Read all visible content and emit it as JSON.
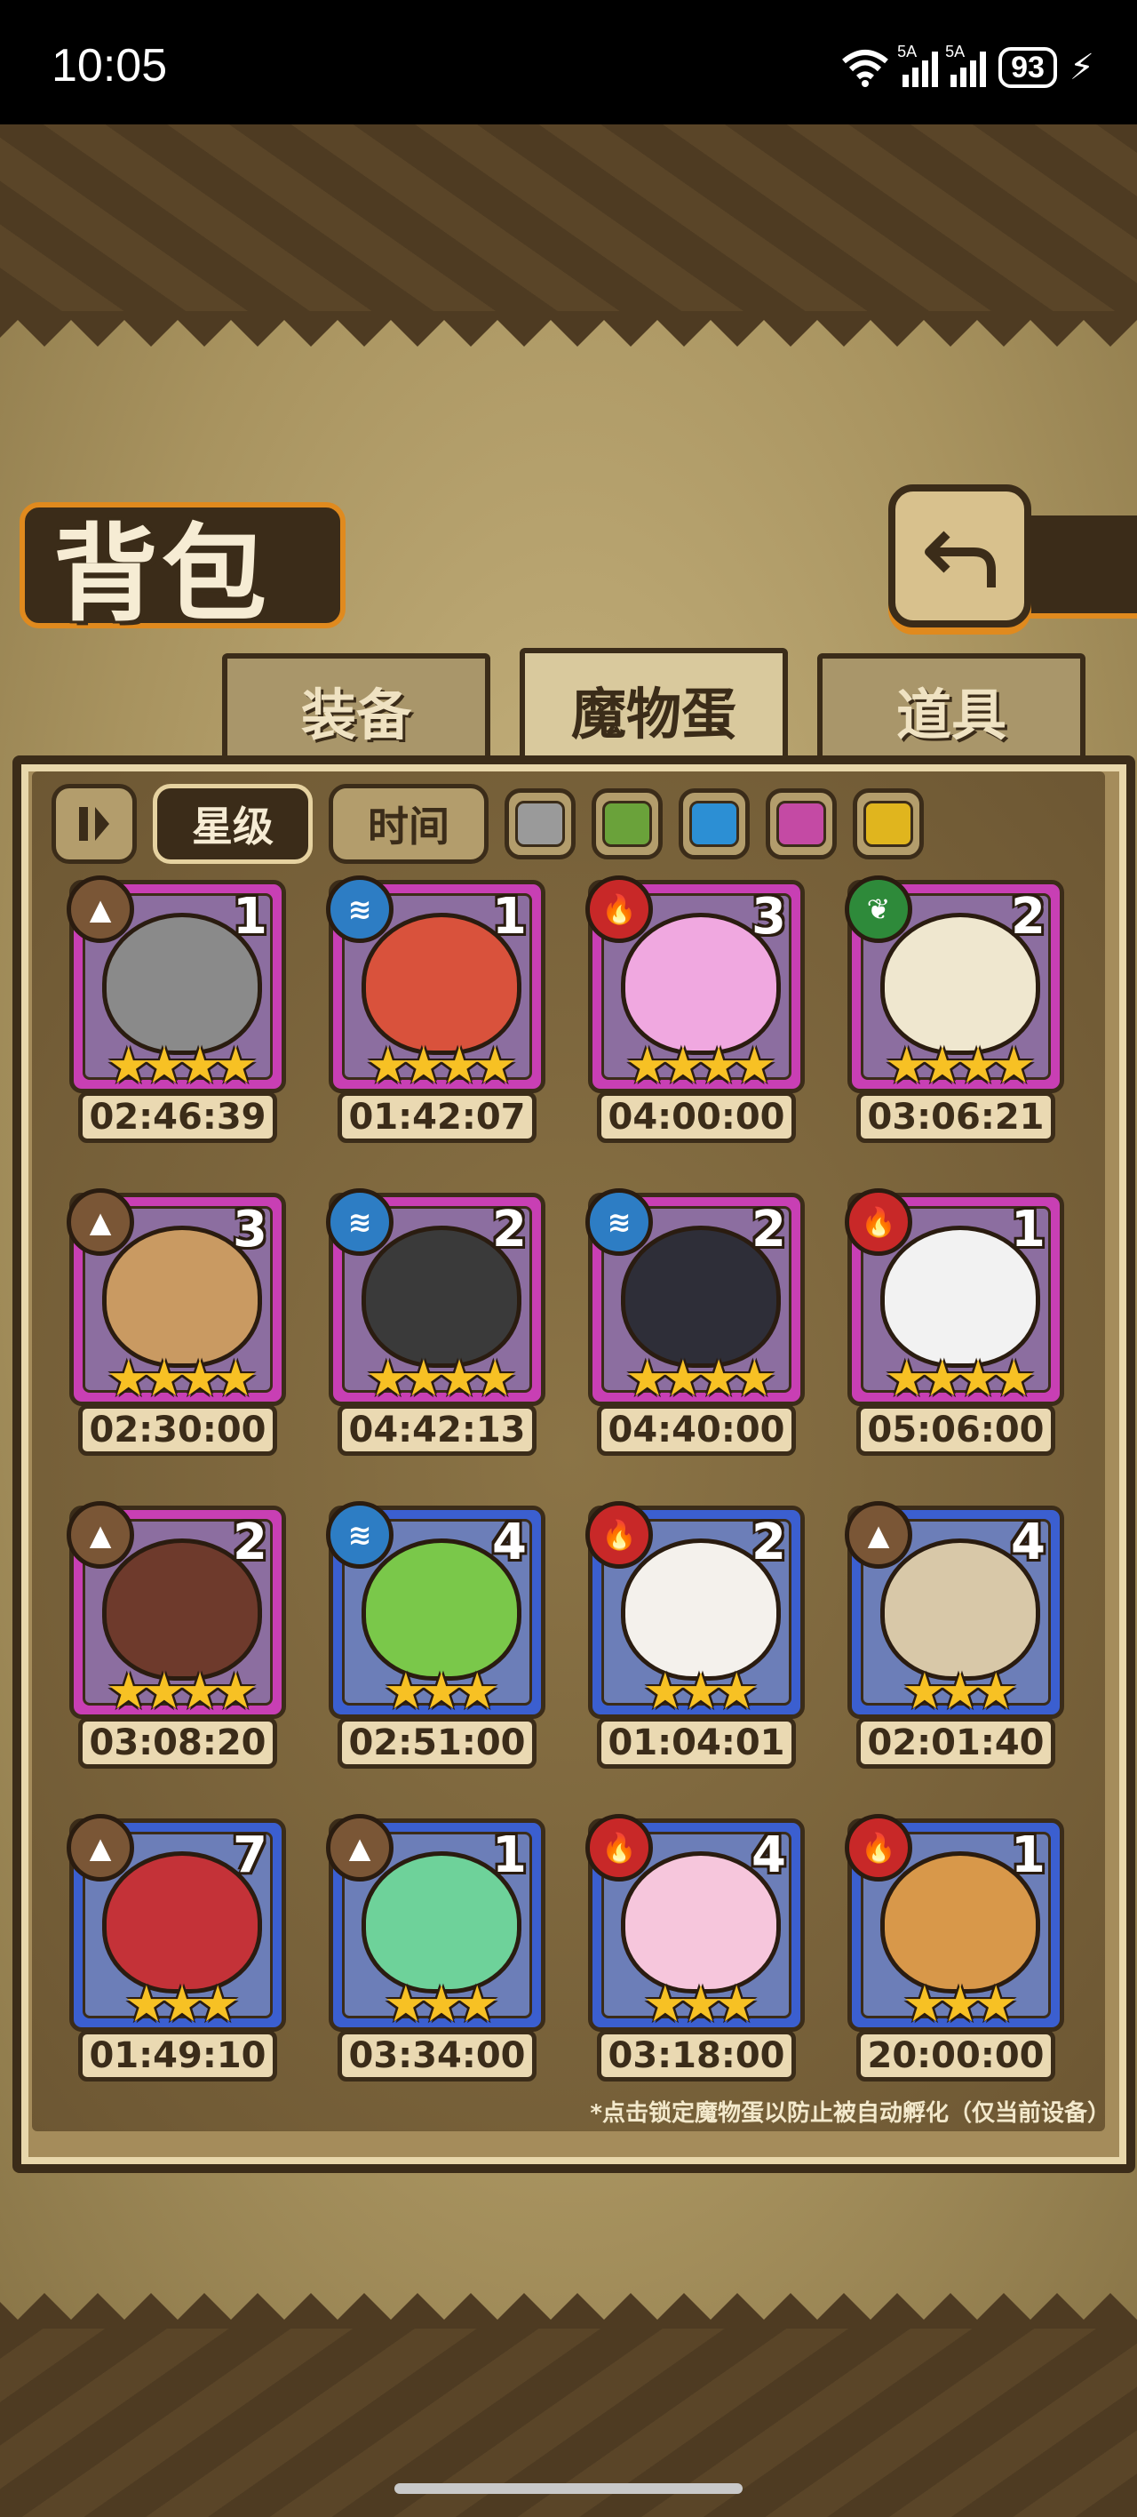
{
  "status_bar": {
    "time": "10:05",
    "signal1_label": "5A",
    "signal2_label": "5A",
    "battery": "93"
  },
  "header": {
    "title": "背包",
    "back_icon": "back-arrow-icon"
  },
  "tabs": [
    {
      "label": "装备",
      "active": false
    },
    {
      "label": "魔物蛋",
      "active": true
    },
    {
      "label": "道具",
      "active": false
    }
  ],
  "filters": {
    "sort_toggle_icon": "sort-toggle-icon",
    "star_label": "星级",
    "time_label": "时间",
    "color_swatches": [
      "#9a9a9a",
      "#6aa23a",
      "#2c8fd4",
      "#c44aa4",
      "#e0b51e"
    ]
  },
  "eggs": [
    {
      "element": "earth",
      "count": "1",
      "stars": "★★★★",
      "time": "02:46:39",
      "rarity": "purple",
      "color": "#8a8a8a"
    },
    {
      "element": "water",
      "count": "1",
      "stars": "★★★★",
      "time": "01:42:07",
      "rarity": "purple",
      "color": "#d9523c"
    },
    {
      "element": "fire",
      "count": "3",
      "stars": "★★★★",
      "time": "04:00:00",
      "rarity": "purple",
      "color": "#f0a8e0"
    },
    {
      "element": "wood",
      "count": "2",
      "stars": "★★★★",
      "time": "03:06:21",
      "rarity": "purple",
      "color": "#efe7cf"
    },
    {
      "element": "earth",
      "count": "3",
      "stars": "★★★★",
      "time": "02:30:00",
      "rarity": "purple",
      "color": "#c99a62"
    },
    {
      "element": "water",
      "count": "2",
      "stars": "★★★★",
      "time": "04:42:13",
      "rarity": "purple",
      "color": "#3a3a3a"
    },
    {
      "element": "water",
      "count": "2",
      "stars": "★★★★",
      "time": "04:40:00",
      "rarity": "purple",
      "color": "#2e2e38"
    },
    {
      "element": "fire",
      "count": "1",
      "stars": "★★★★",
      "time": "05:06:00",
      "rarity": "purple",
      "color": "#f2f2f2"
    },
    {
      "element": "earth",
      "count": "2",
      "stars": "★★★★",
      "time": "03:08:20",
      "rarity": "purple",
      "color": "#6e3a2c"
    },
    {
      "element": "water",
      "count": "4",
      "stars": "★★★",
      "time": "02:51:00",
      "rarity": "blue",
      "color": "#7ac84a"
    },
    {
      "element": "fire",
      "count": "2",
      "stars": "★★★",
      "time": "01:04:01",
      "rarity": "blue",
      "color": "#f4f1ec"
    },
    {
      "element": "earth",
      "count": "4",
      "stars": "★★★",
      "time": "02:01:40",
      "rarity": "blue",
      "color": "#d8c8a8"
    },
    {
      "element": "earth",
      "count": "7",
      "stars": "★★★",
      "time": "01:49:10",
      "rarity": "blue",
      "color": "#c43238"
    },
    {
      "element": "earth",
      "count": "1",
      "stars": "★★★",
      "time": "03:34:00",
      "rarity": "blue",
      "color": "#6ed29a"
    },
    {
      "element": "fire",
      "count": "4",
      "stars": "★★★",
      "time": "03:18:00",
      "rarity": "blue",
      "color": "#f6c6dc"
    },
    {
      "element": "fire",
      "count": "1",
      "stars": "★★★",
      "time": "20:00:00",
      "rarity": "blue",
      "color": "#d8984a"
    }
  ],
  "note": "*点击锁定魔物蛋以防止被自动孵化（仅当前设备）"
}
